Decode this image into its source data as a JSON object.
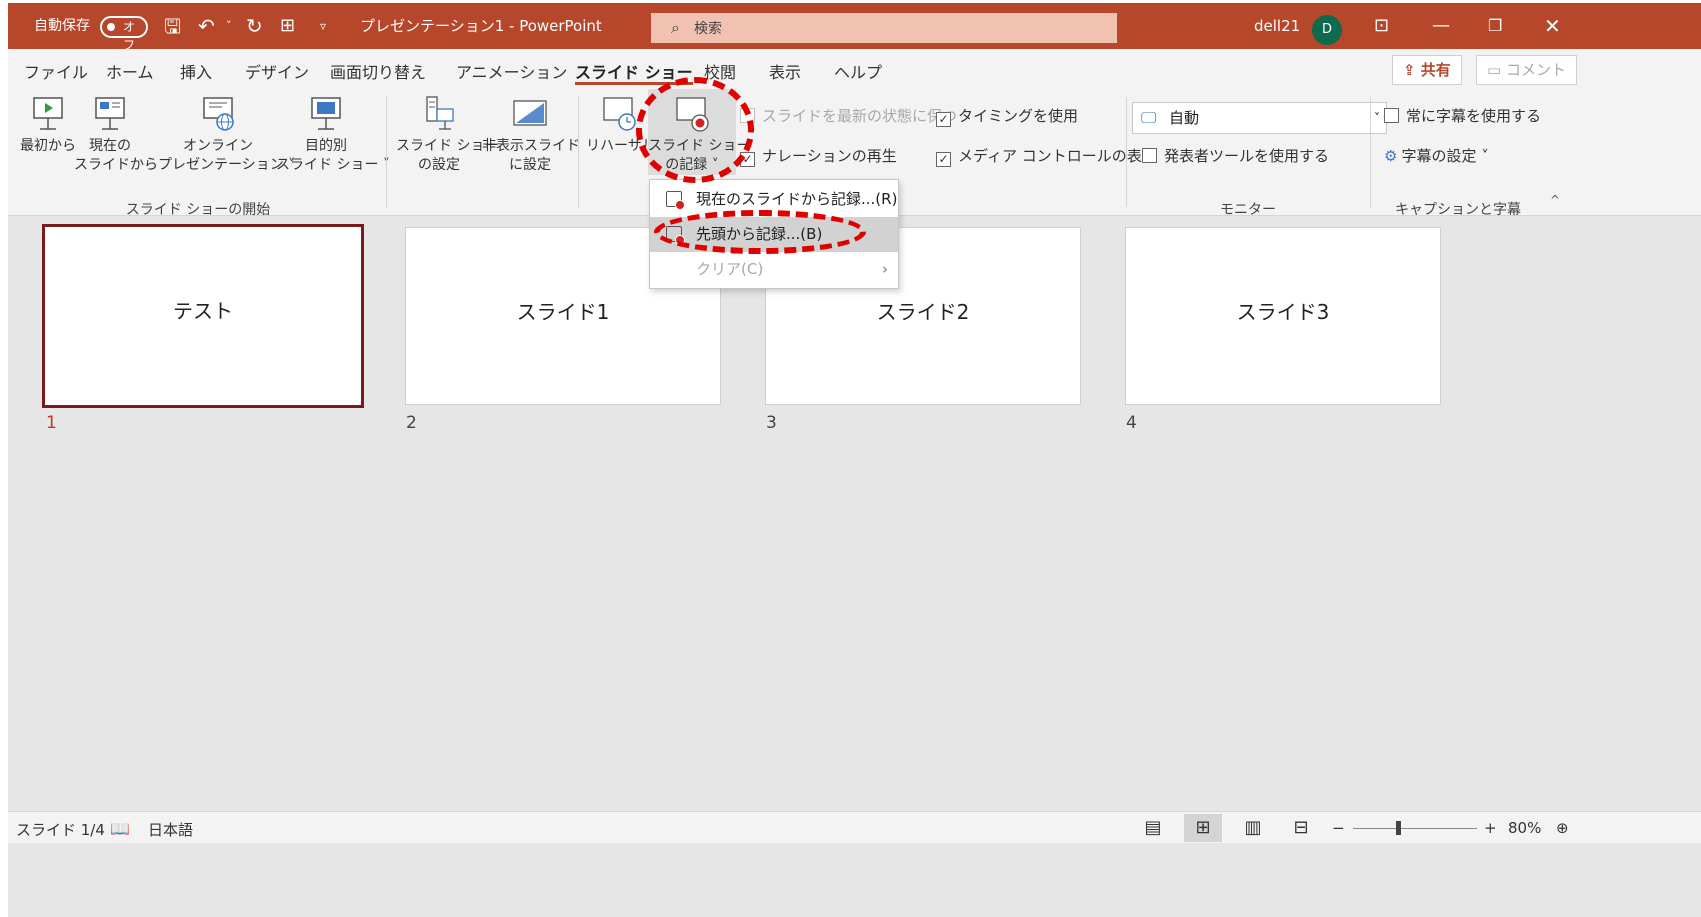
{
  "titlebar": {
    "autosave_label": "自動保存",
    "autosave_state": "オフ",
    "doc_title": "プレゼンテーション1 - PowerPoint",
    "search_placeholder": "検索",
    "user_name": "dell21",
    "avatar_initial": "D"
  },
  "tabs": [
    "ファイル",
    "ホーム",
    "挿入",
    "デザイン",
    "画面切り替え",
    "アニメーション",
    "スライド ショー",
    "校閲",
    "表示",
    "ヘルプ"
  ],
  "share_label": "共有",
  "comment_label": "コメント",
  "ribbon": {
    "from_beginning": "最初から",
    "from_current_1": "現在の",
    "from_current_2": "スライドから",
    "online_1": "オンライン",
    "online_2": "プレゼンテーション ˅",
    "custom_1": "目的別",
    "custom_2": "スライド ショー ˅",
    "group_start": "スライド ショーの開始",
    "setup_1": "スライド ショー",
    "setup_2": "の設定",
    "hide_1": "非表示スライド",
    "hide_2": "に設定",
    "rehearse": "リハーサル",
    "record_1": "スライド ショー",
    "record_2": "の記録 ˅",
    "keep_updated": "スライドを最新の状態に保つ",
    "use_timings": "タイミングを使用",
    "play_narration": "ナレーションの再生",
    "show_media": "メディア コントロールの表示",
    "monitor_value": "自動",
    "use_presenter": "発表者ツールを使用する",
    "group_monitor": "モニター",
    "always_subtitles": "常に字幕を使用する",
    "subtitle_settings": "字幕の設定 ˅",
    "group_caption": "キャプションと字幕"
  },
  "menu": {
    "from_current": "現在のスライドから記録...(R)",
    "from_beginning": "先頭から記録...(B)",
    "clear": "クリア(C)"
  },
  "slides": [
    {
      "title": "テスト",
      "num": "1"
    },
    {
      "title": "スライド1",
      "num": "2"
    },
    {
      "title": "スライド2",
      "num": "3"
    },
    {
      "title": "スライド3",
      "num": "4"
    }
  ],
  "statusbar": {
    "slide_info": "スライド 1/4",
    "language": "日本語",
    "zoom": "80%"
  },
  "colors": {
    "accent": "#b7472a",
    "annotation": "#e00000",
    "selected_border": "#7b1c1c"
  }
}
